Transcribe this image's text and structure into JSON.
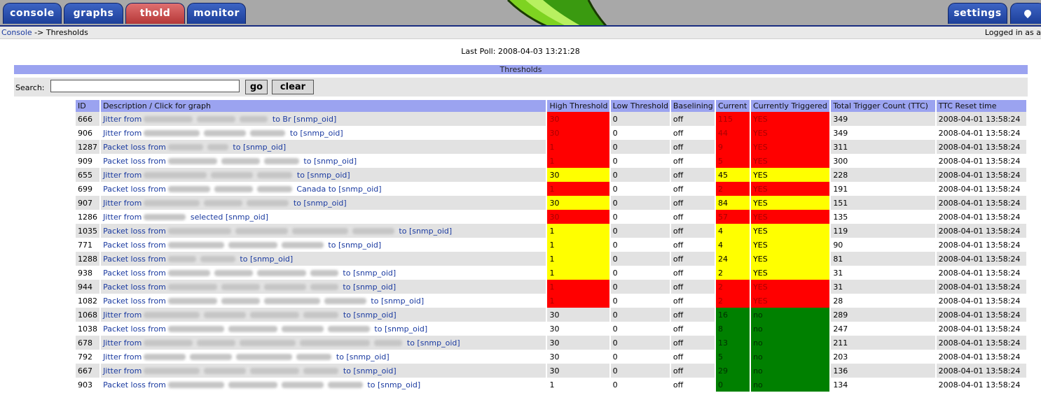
{
  "nav": {
    "tabs": [
      "console",
      "graphs",
      "thold",
      "monitor"
    ],
    "settings": "settings"
  },
  "breadcrumb": {
    "home": "Console",
    "separator": "->",
    "current": "Thresholds"
  },
  "login_text": "Logged in as a",
  "last_poll": "Last Poll: 2008-04-03 13:21:28",
  "section_title": "Thresholds",
  "search": {
    "label": "Search:",
    "value": "",
    "go": "go",
    "clear": "clear"
  },
  "colors": {
    "red": "#ff0000",
    "yellow": "#ffff00",
    "green": "#008000",
    "header": "#9ba3f0"
  },
  "table": {
    "columns": [
      "ID",
      "Description / Click for graph",
      "High Threshold",
      "Low Threshold",
      "Baselining",
      "Current",
      "Currently Triggered",
      "Total Trigger Count (TTC)",
      "TTC Reset time"
    ],
    "rows": [
      {
        "id": "666",
        "desc_pre": "Jitter from",
        "desc_mid": "to Br",
        "oid": "[snmp_oid]",
        "high": "30",
        "low": "0",
        "base": "off",
        "current": "115",
        "trig": "YES",
        "ttc": "349",
        "reset": "2008-04-01 13:58:24",
        "status": "red"
      },
      {
        "id": "906",
        "desc_pre": "Jitter from",
        "desc_mid": "to",
        "oid": "[snmp_oid]",
        "high": "30",
        "low": "0",
        "base": "off",
        "current": "44",
        "trig": "YES",
        "ttc": "349",
        "reset": "2008-04-01 13:58:24",
        "status": "red"
      },
      {
        "id": "1287",
        "desc_pre": "Packet loss from",
        "desc_mid": "to",
        "oid": "[snmp_oid]",
        "high": "1",
        "low": "0",
        "base": "off",
        "current": "9",
        "trig": "YES",
        "ttc": "311",
        "reset": "2008-04-01 13:58:24",
        "status": "red"
      },
      {
        "id": "909",
        "desc_pre": "Packet loss from",
        "desc_mid": "to",
        "oid": "[snmp_oid]",
        "high": "1",
        "low": "0",
        "base": "off",
        "current": "5",
        "trig": "YES",
        "ttc": "300",
        "reset": "2008-04-01 13:58:24",
        "status": "red"
      },
      {
        "id": "655",
        "desc_pre": "Jitter from",
        "desc_mid": "to",
        "oid": "[snmp_oid]",
        "high": "30",
        "low": "0",
        "base": "off",
        "current": "45",
        "trig": "YES",
        "ttc": "228",
        "reset": "2008-04-01 13:58:24",
        "status": "yellow"
      },
      {
        "id": "699",
        "desc_pre": "Packet loss from",
        "desc_mid": "Canada to",
        "oid": "[snmp_oid]",
        "high": "1",
        "low": "0",
        "base": "off",
        "current": "2",
        "trig": "YES",
        "ttc": "191",
        "reset": "2008-04-01 13:58:24",
        "status": "red"
      },
      {
        "id": "907",
        "desc_pre": "Jitter from",
        "desc_mid": "to",
        "oid": "[snmp_oid]",
        "high": "30",
        "low": "0",
        "base": "off",
        "current": "84",
        "trig": "YES",
        "ttc": "151",
        "reset": "2008-04-01 13:58:24",
        "status": "yellow"
      },
      {
        "id": "1286",
        "desc_pre": "Jitter from",
        "desc_mid": "selected",
        "oid": "[snmp_oid]",
        "high": "30",
        "low": "0",
        "base": "off",
        "current": "57",
        "trig": "YES",
        "ttc": "135",
        "reset": "2008-04-01 13:58:24",
        "status": "red"
      },
      {
        "id": "1035",
        "desc_pre": "Packet loss from",
        "desc_mid": "to",
        "oid": "[snmp_oid]",
        "high": "1",
        "low": "0",
        "base": "off",
        "current": "4",
        "trig": "YES",
        "ttc": "119",
        "reset": "2008-04-01 13:58:24",
        "status": "yellow"
      },
      {
        "id": "771",
        "desc_pre": "Packet loss from",
        "desc_mid": "to",
        "oid": "[snmp_oid]",
        "high": "1",
        "low": "0",
        "base": "off",
        "current": "4",
        "trig": "YES",
        "ttc": "90",
        "reset": "2008-04-01 13:58:24",
        "status": "yellow"
      },
      {
        "id": "1288",
        "desc_pre": "Packet loss from",
        "desc_mid": "to",
        "oid": "[snmp_oid]",
        "high": "1",
        "low": "0",
        "base": "off",
        "current": "24",
        "trig": "YES",
        "ttc": "81",
        "reset": "2008-04-01 13:58:24",
        "status": "yellow"
      },
      {
        "id": "938",
        "desc_pre": "Packet loss from",
        "desc_mid": "to",
        "oid": "[snmp_oid]",
        "high": "1",
        "low": "0",
        "base": "off",
        "current": "2",
        "trig": "YES",
        "ttc": "31",
        "reset": "2008-04-01 13:58:24",
        "status": "yellow"
      },
      {
        "id": "944",
        "desc_pre": "Packet loss from",
        "desc_mid": "to",
        "oid": "[snmp_oid]",
        "high": "1",
        "low": "0",
        "base": "off",
        "current": "2",
        "trig": "YES",
        "ttc": "31",
        "reset": "2008-04-01 13:58:24",
        "status": "red"
      },
      {
        "id": "1082",
        "desc_pre": "Packet loss from",
        "desc_mid": "to",
        "oid": "[snmp_oid]",
        "high": "1",
        "low": "0",
        "base": "off",
        "current": "2",
        "trig": "YES",
        "ttc": "28",
        "reset": "2008-04-01 13:58:24",
        "status": "red"
      },
      {
        "id": "1068",
        "desc_pre": "Jitter from",
        "desc_mid": "to",
        "oid": "[snmp_oid]",
        "high": "30",
        "low": "0",
        "base": "off",
        "current": "16",
        "trig": "no",
        "ttc": "289",
        "reset": "2008-04-01 13:58:24",
        "status": "green"
      },
      {
        "id": "1038",
        "desc_pre": "Packet loss from",
        "desc_mid": "to",
        "oid": "[snmp_oid]",
        "high": "30",
        "low": "0",
        "base": "off",
        "current": "8",
        "trig": "no",
        "ttc": "247",
        "reset": "2008-04-01 13:58:24",
        "status": "green"
      },
      {
        "id": "678",
        "desc_pre": "Jitter from",
        "desc_mid": "to",
        "oid": "[snmp_oid]",
        "high": "30",
        "low": "0",
        "base": "off",
        "current": "13",
        "trig": "no",
        "ttc": "211",
        "reset": "2008-04-01 13:58:24",
        "status": "green"
      },
      {
        "id": "792",
        "desc_pre": "Jitter from",
        "desc_mid": "to",
        "oid": "[snmp_oid]",
        "high": "30",
        "low": "0",
        "base": "off",
        "current": "5",
        "trig": "no",
        "ttc": "203",
        "reset": "2008-04-01 13:58:24",
        "status": "green"
      },
      {
        "id": "667",
        "desc_pre": "Jitter from",
        "desc_mid": "to",
        "oid": "[snmp_oid]",
        "high": "30",
        "low": "0",
        "base": "off",
        "current": "29",
        "trig": "no",
        "ttc": "136",
        "reset": "2008-04-01 13:58:24",
        "status": "green"
      },
      {
        "id": "903",
        "desc_pre": "Packet loss from",
        "desc_mid": "to",
        "oid": "[snmp_oid]",
        "high": "1",
        "low": "0",
        "base": "off",
        "current": "0",
        "trig": "no",
        "ttc": "134",
        "reset": "2008-04-01 13:58:24",
        "status": "green"
      }
    ]
  }
}
